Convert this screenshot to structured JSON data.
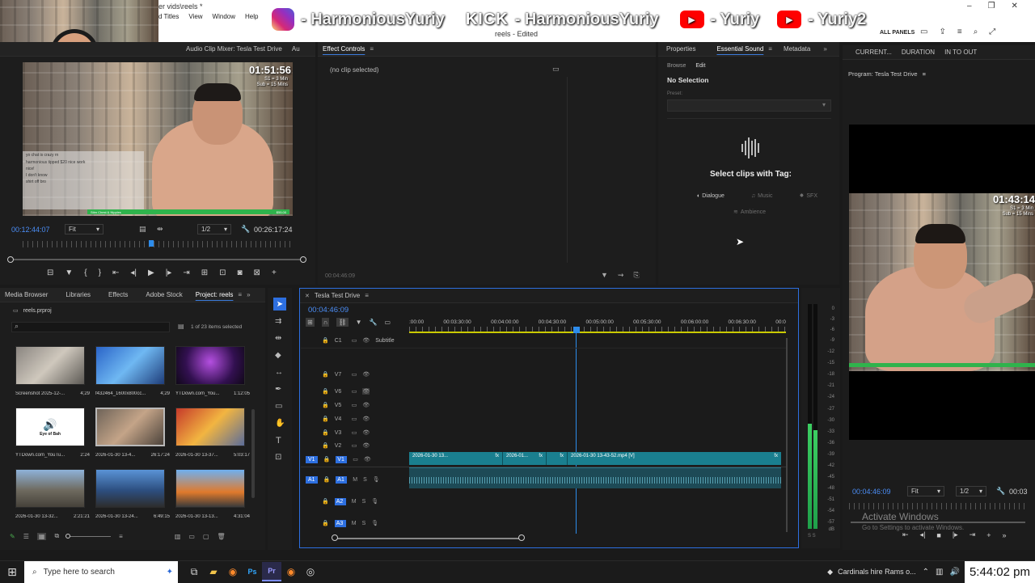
{
  "titlebar": {
    "path": "er vids\\reels *",
    "document": "reels - Edited",
    "menu": [
      "d Titles",
      "View",
      "Window",
      "Help"
    ],
    "right_items": [
      "ALL PANELS"
    ]
  },
  "overlay": {
    "instagram": "- HarmoniousYuriy",
    "kick_logo": "KICK",
    "kick": "- HarmoniousYuriy",
    "youtube1": "- Yuriy",
    "youtube2": "- Yuriy2"
  },
  "source_monitor": {
    "tabs": [
      "Audio Clip Mixer: Tesla Test Drive",
      "Au"
    ],
    "timecode_left": "00:12:44:07",
    "fit": "Fit",
    "resolution": "1/2",
    "timecode_right": "00:26:17:24",
    "overlay_time": "01:51:56",
    "overlay_sub1": "S1 = 3 Min",
    "overlay_sub2": "Sub = 15 Mins",
    "chat_lines": [
      "yo chat is crazy rn",
      "harmonious tipped $20 nice work",
      "nice!",
      "I don't know",
      "shirt off bro"
    ],
    "green_bar_text": "Stim Chest & Nipples",
    "green_bar_amount": "$55.00"
  },
  "effect_controls": {
    "tab": "Effect Controls",
    "no_clip": "(no clip selected)",
    "timecode": "00:04:46:09"
  },
  "essential_sound": {
    "tabs": [
      "Properties",
      "Essential Sound",
      "Metadata"
    ],
    "subtabs": [
      "Browse",
      "Edit"
    ],
    "no_selection": "No Selection",
    "preset_label": "Preset:",
    "select_tag": "Select clips with Tag:",
    "tags": [
      "Dialogue",
      "Music",
      "SFX",
      "Ambience"
    ]
  },
  "program_monitor": {
    "tabs": [
      "CURRENT...",
      "DURATION",
      "IN TO OUT"
    ],
    "title": "Program: Tesla Test Drive",
    "overlay_time": "01:43:14",
    "overlay_sub1": "S1 = 3 Min",
    "overlay_sub2": "Sub = 15 Mins",
    "timecode": "00:04:46:09",
    "fit": "Fit",
    "resolution": "1/2",
    "timecode_right": "00:03",
    "watermark1": "Activate Windows",
    "watermark2": "Go to Settings to activate Windows."
  },
  "project_panel": {
    "tabs": [
      "Media Browser",
      "Libraries",
      "Effects",
      "Adobe Stock",
      "Project: reels"
    ],
    "file": "reels.prproj",
    "count": "1 of 23 items selected",
    "items": [
      {
        "name": "Screenshot 2025-12-...",
        "dur": "4;29"
      },
      {
        "name": "f432464_1600x800cc...",
        "dur": "4;29"
      },
      {
        "name": "YTDown.com_You...",
        "dur": "1:12:05"
      },
      {
        "name": "YTDown.com_YouTu...",
        "dur": "2:24"
      },
      {
        "name": "2026-01-30 13-4...",
        "dur": "26:17:24"
      },
      {
        "name": "2026-01-30 13-37...",
        "dur": "5:03:17"
      },
      {
        "name": "2026-01-30 13-32...",
        "dur": "2:21:21"
      },
      {
        "name": "2026-01-30 13-24...",
        "dur": "6:49:15"
      },
      {
        "name": "2026-01-30 13-13...",
        "dur": "4:31:04"
      }
    ],
    "eye_of_bah": "Eye of Bah"
  },
  "timeline": {
    "title": "Tesla Test Drive",
    "timecode": "00:04:46:09",
    "ruler": [
      ":00:00",
      "00:03:30:00",
      "00:04:00:00",
      "00:04:30:00",
      "00:05:00:00",
      "00:05:30:00",
      "00:06:00:00",
      "00:06:30:00",
      "00:0"
    ],
    "subtitle_track": "C1",
    "subtitle_label": "Subtitle",
    "video_tracks": [
      "V7",
      "V6",
      "V5",
      "V4",
      "V3",
      "V2",
      "V1"
    ],
    "audio_tracks": [
      "A1",
      "A2",
      "A3"
    ],
    "clip_labels": [
      "2026-01-30 13...",
      "2026-01...",
      "2026-01-30 13-43-52.mp4 [V]"
    ],
    "meter_scale": [
      "0",
      "-3",
      "-6",
      "-9",
      "-12",
      "-15",
      "-18",
      "-21",
      "-24",
      "-27",
      "-30",
      "-33",
      "-36",
      "-39",
      "-42",
      "-45",
      "-48",
      "-51",
      "-54",
      "-57",
      "dB"
    ]
  },
  "taskbar": {
    "search_placeholder": "Type here to search",
    "news": "Cardinals hire Rams o...",
    "clock": "5:44:02 pm"
  },
  "colors": {
    "accent_blue": "#2d8ceb",
    "clip_teal": "#1a7f8f",
    "audio_green": "#1fa04a",
    "panel_bg": "#1d1d1d"
  }
}
